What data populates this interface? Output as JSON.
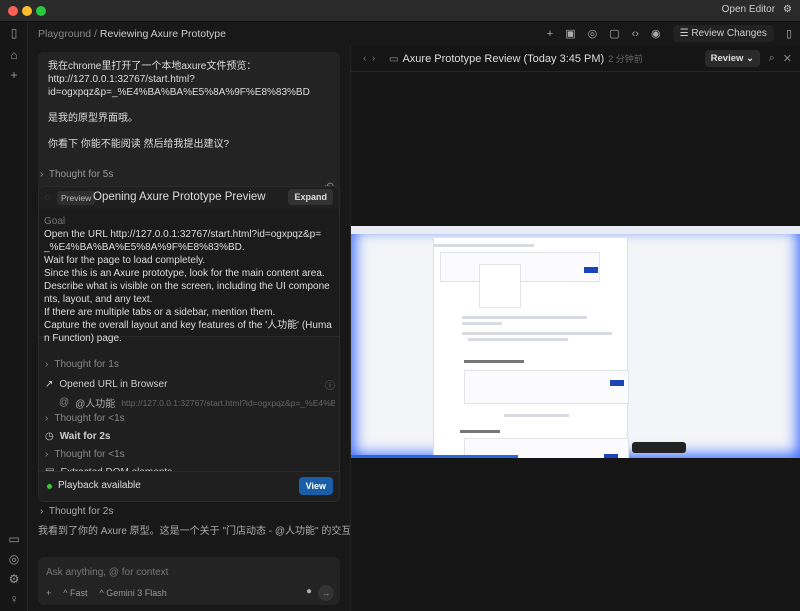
{
  "titlebar": {
    "open_editor": "Open Editor"
  },
  "header": {
    "breadcrumb_root": "Playground",
    "breadcrumb_sep": "/",
    "breadcrumb_current": "Reviewing Axure Prototype",
    "review_changes": "Review Changes"
  },
  "chat": {
    "user_message": "我在chrome里打开了一个本地axure文件预览：\nhttp://127.0.0.1:32767/start.html?\nid=ogxpqz&p=_%E4%BA%BA%E5%8A%9F%E8%83%BD\n\n是我的原型界面哦。\n\n你看下 你能不能阅读 然后给我提出建议?",
    "thought_1": "Thought for 5s",
    "task": {
      "badge": "Preview",
      "title": "Opening Axure Prototype Preview",
      "expand": "Expand",
      "goal_label": "Goal",
      "goal_text": "Open the URL http://127.0.0.1:32767/start.html?id=ogxpqz&p=_%E4%BA%BA%E5%8A%9F%E8%83%BD.\nWait for the page to load completely.\nSince this is an Axure prototype, look for the main content area.\nDescribe what is visible on the screen, including the UI components, layout, and any text.\nIf there are multiple tabs or a sidebar, mention them.\nCapture the overall layout and key features of the '人功能' (Human Function) page.",
      "steps": [
        {
          "label": "Thought for 1s"
        },
        {
          "label": "Opened URL in Browser",
          "tag": "@人功能",
          "url": "http://127.0.0.1:32767/start.html?id=ogxpqz&p=_%E4%BA%BA..."
        },
        {
          "label": "Thought for <1s"
        },
        {
          "label": "Wait for 2s"
        },
        {
          "label": "Thought for <1s"
        },
        {
          "label": "Extracted DOM elements"
        }
      ],
      "playback": "Playback available",
      "view": "View"
    },
    "thought_2": "Thought for 2s",
    "reply": "我看到了你的 Axure 原型。这是一个关于 \"门店动态 - @人功能\" 的交互设",
    "input_placeholder": "Ask anything, @ for context",
    "mode": "Fast",
    "model": "Gemini 3 Flash"
  },
  "preview": {
    "title": "Axure Prototype Review (Today 3:45 PM)",
    "time_ago": "2 分钟前",
    "review": "Review",
    "progress": 0.37
  }
}
